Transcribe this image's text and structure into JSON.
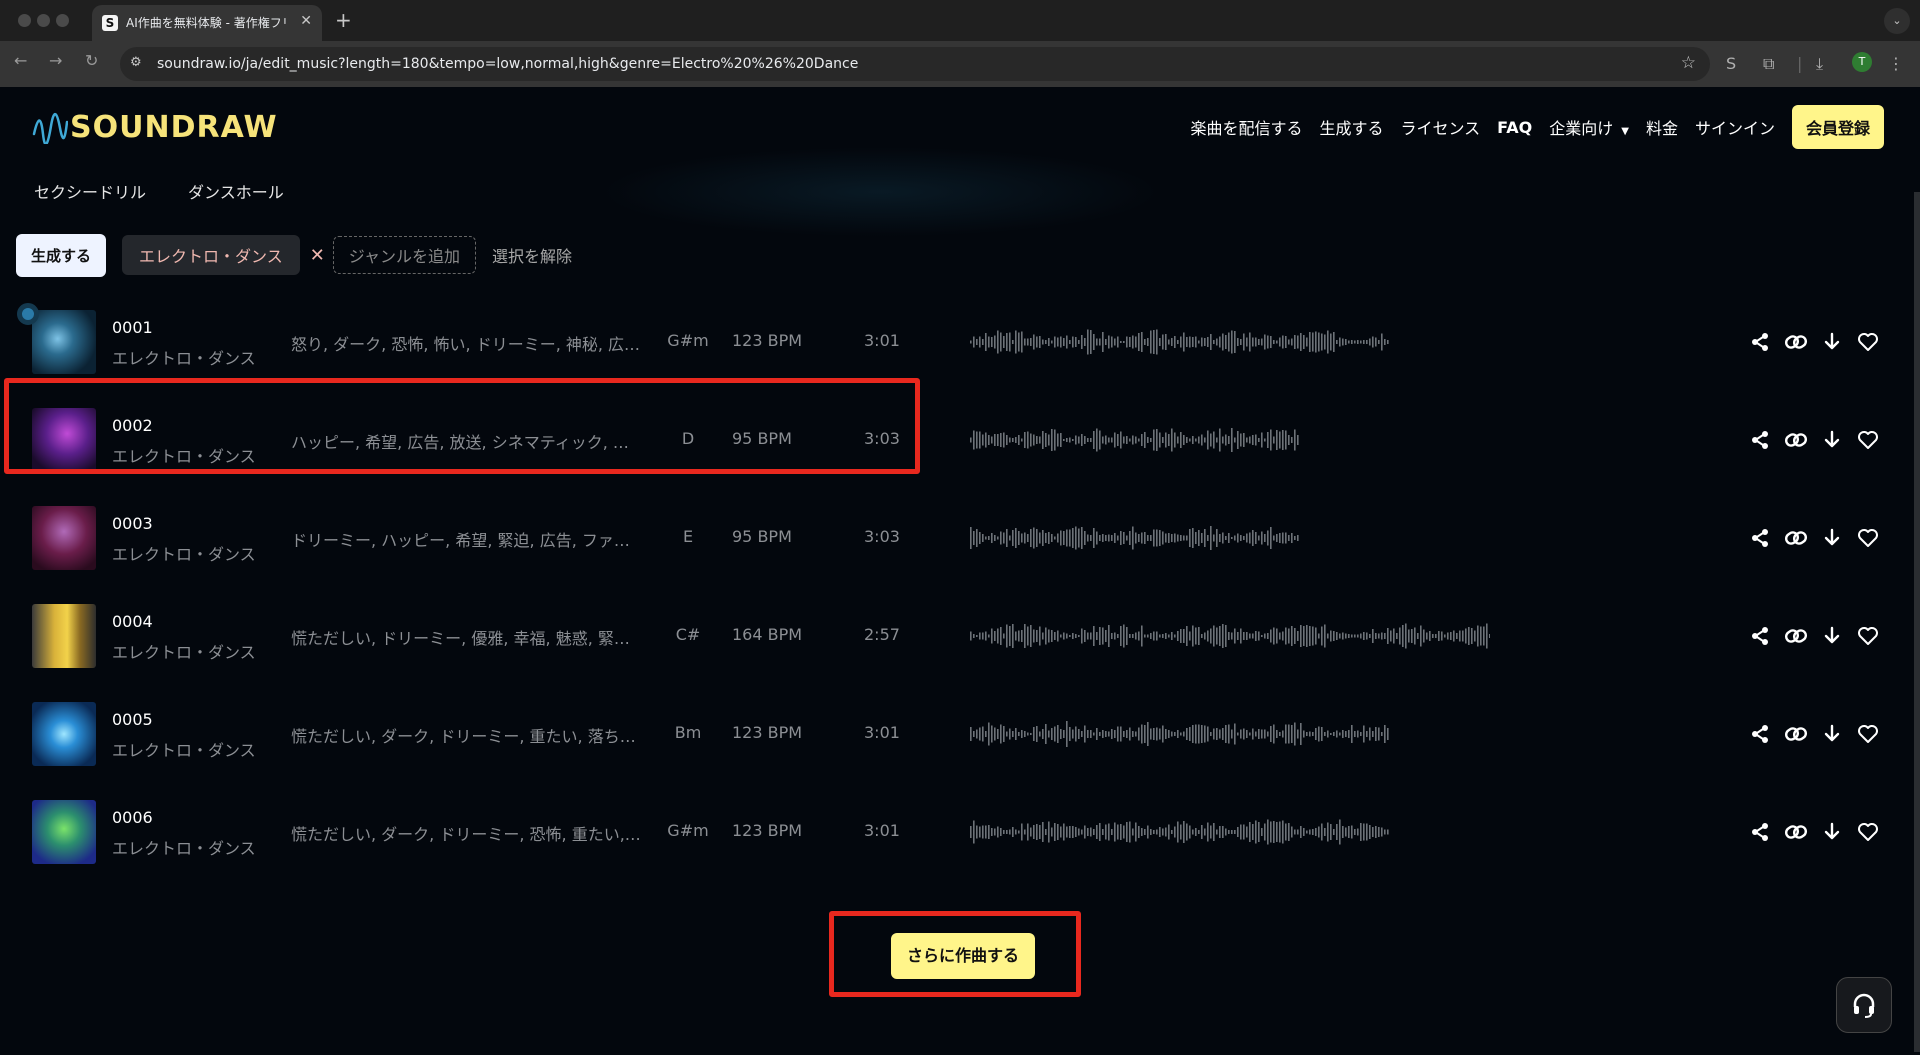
{
  "browser": {
    "tab_title": "AI作曲を無料体験 - 著作権フリー",
    "tab_favicon": "S",
    "url": "soundraw.io/ja/edit_music?length=180&tempo=low,normal,high&genre=Electro%20%26%20Dance",
    "profile_initial": "T"
  },
  "header": {
    "logo_text": "SOUNDRAW",
    "nav": {
      "distribute": "楽曲を配信する",
      "generate": "生成する",
      "license": "ライセンス",
      "faq": "FAQ",
      "business": "企業向け",
      "pricing": "料金",
      "signin": "サインイン",
      "signup": "会員登録"
    }
  },
  "subtags": [
    "セクシードリル",
    "ダンスホール"
  ],
  "filters": {
    "generate_label": "生成する",
    "genre_chip": "エレクトロ・ダンス",
    "remove_symbol": "✕",
    "add_genre": "ジャンルを追加",
    "clear": "選択を解除"
  },
  "tracks": [
    {
      "num": "0001",
      "genre": "エレクトロ・ダンス",
      "tags": "怒り, ダーク, 恐怖, 怖い, ドリーミー, 神秘, 広告, 放送",
      "key": "G#m",
      "bpm": "123 BPM",
      "duration": "3:01",
      "selected": true
    },
    {
      "num": "0002",
      "genre": "エレクトロ・ダンス",
      "tags": "ハッピー, 希望, 広告, 放送, シネマティック, コーポレート",
      "key": "D",
      "bpm": "95 BPM",
      "duration": "3:03",
      "selected": false
    },
    {
      "num": "0003",
      "genre": "エレクトロ・ダンス",
      "tags": "ドリーミー, ハッピー, 希望, 緊迫, 広告, ファッション",
      "key": "E",
      "bpm": "95 BPM",
      "duration": "3:03",
      "selected": false
    },
    {
      "num": "0004",
      "genre": "エレクトロ・ダンス",
      "tags": "慌ただしい, ドリーミー, 優雅, 幸福, 魅惑, 緊迫, 広告",
      "key": "C#",
      "bpm": "164 BPM",
      "duration": "2:57",
      "selected": false
    },
    {
      "num": "0005",
      "genre": "エレクトロ・ダンス",
      "tags": "慌ただしい, ダーク, ドリーミー, 重たい, 落ち着いた",
      "key": "Bm",
      "bpm": "123 BPM",
      "duration": "3:01",
      "selected": false
    },
    {
      "num": "0006",
      "genre": "エレクトロ・ダンス",
      "tags": "慌ただしい, ダーク, ドリーミー, 恐怖, 重たい, 広告",
      "key": "G#m",
      "bpm": "123 BPM",
      "duration": "3:01",
      "selected": false
    }
  ],
  "more_button": "さらに作曲する",
  "colors": {
    "accent_yellow": "#fff58a",
    "highlight_red": "#e8281e",
    "page_bg": "#03070d"
  },
  "icons": [
    "share-icon",
    "link-icon",
    "download-icon",
    "heart-icon",
    "headset-icon"
  ]
}
